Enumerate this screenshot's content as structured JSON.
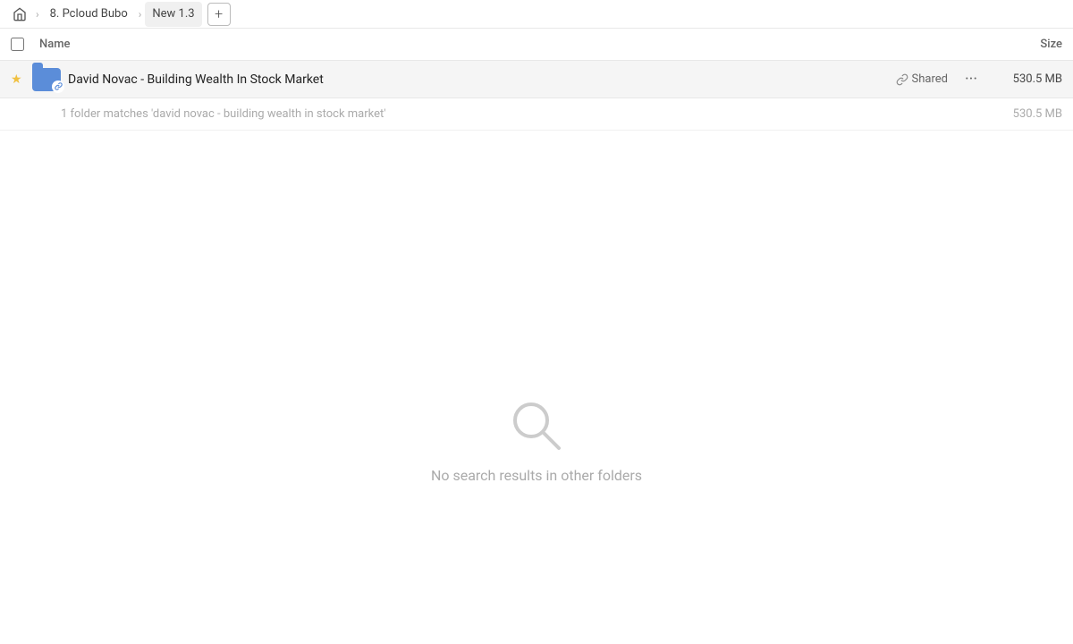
{
  "breadcrumb": {
    "home_icon": "🏠",
    "items": [
      {
        "label": "8. Pcloud Bubo",
        "id": "pcloud-bubo"
      },
      {
        "label": "New 1.3",
        "id": "new-1-3"
      }
    ],
    "add_button_label": "+"
  },
  "columns": {
    "name_label": "Name",
    "size_label": "Size"
  },
  "files": [
    {
      "name": "David Novac - Building Wealth In Stock Market",
      "shared_label": "Shared",
      "size": "530.5 MB",
      "starred": true
    }
  ],
  "summary": {
    "text": "1 folder matches 'david novac - building wealth in stock market'",
    "size": "530.5 MB"
  },
  "empty_state": {
    "message": "No search results in other folders"
  }
}
